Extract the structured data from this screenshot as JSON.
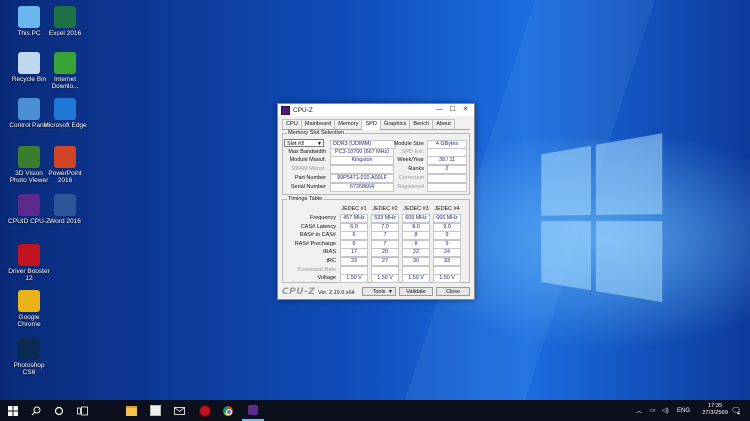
{
  "desktop_icons": [
    {
      "label": "This PC",
      "icon": "this-pc-icon",
      "color": "#6ab7f0"
    },
    {
      "label": "Excel 2016",
      "icon": "excel-icon",
      "color": "#1e7145"
    },
    {
      "label": "Recycle Bin",
      "icon": "recycle-bin-icon",
      "color": "#c0d8f0"
    },
    {
      "label": "Internet Downlo...",
      "icon": "idm-icon",
      "color": "#3aa335"
    },
    {
      "label": "Control Panel",
      "icon": "control-panel-icon",
      "color": "#4b8fd4"
    },
    {
      "label": "Microsoft Edge",
      "icon": "edge-icon",
      "color": "#1f77d6"
    },
    {
      "label": "3D Vision Photo Viewer",
      "icon": "3d-vision-icon",
      "color": "#3a7d2c"
    },
    {
      "label": "PowerPoint 2016",
      "icon": "powerpoint-icon",
      "color": "#d04423"
    },
    {
      "label": "CPUID CPU-Z",
      "icon": "cpuz-icon",
      "color": "#5b2a8c"
    },
    {
      "label": "Word 2016",
      "icon": "word-icon",
      "color": "#2b579a"
    },
    {
      "label": "Driver Booster 12",
      "icon": "driver-booster-icon",
      "color": "#c0141e"
    },
    {
      "label": "Google Chrome",
      "icon": "chrome-icon",
      "color": "#e8b21a"
    },
    {
      "label": "Photoshop CS6",
      "icon": "photoshop-icon",
      "color": "#0b2a52"
    }
  ],
  "window": {
    "title": "CPU-Z",
    "minimize": "—",
    "maximize": "☐",
    "close": "✕",
    "tabs": [
      "CPU",
      "Mainboard",
      "Memory",
      "SPD",
      "Graphics",
      "Bench",
      "About"
    ],
    "active_tab": "SPD",
    "slot_group_title": "Memory Slot Selection",
    "slot_selected": "Slot #2",
    "memory_type": "DDR3 (UDIMM)",
    "labels": {
      "module_size": "Module Size",
      "max_bandwidth": "Max Bandwidth",
      "spd_ext": "SPD Ext.",
      "module_manuf": "Module Manuf.",
      "week_year": "Week/Year",
      "dram_manuf": "DRAM Manuf.",
      "ranks": "Ranks",
      "part_number": "Part Number",
      "correction": "Correction",
      "serial_number": "Serial Number",
      "registered": "Registered"
    },
    "values": {
      "module_size": "4 GBytes",
      "max_bandwidth": "PC3-10700 (667 MHz)",
      "spd_ext": "",
      "module_manuf": "Kingston",
      "week_year": "38 / 11",
      "dram_manuf": "",
      "ranks": "2",
      "part_number": "99P5471-010.A00LF",
      "correction": "",
      "serial_number": "67268664",
      "registered": ""
    },
    "timings_title": "Timings Table",
    "timing_headers": [
      "JEDEC #1",
      "JEDEC #2",
      "JEDEC #3",
      "JEDEC #4"
    ],
    "timing_rows": [
      {
        "label": "Frequency",
        "values": [
          "457 MHz",
          "533 MHz",
          "609 MHz",
          "666 MHz"
        ]
      },
      {
        "label": "CAS# Latency",
        "values": [
          "6.0",
          "7.0",
          "8.0",
          "9.0"
        ]
      },
      {
        "label": "RAS# to CAS#",
        "values": [
          "6",
          "7",
          "8",
          "9"
        ]
      },
      {
        "label": "RAS# Precharge",
        "values": [
          "6",
          "7",
          "8",
          "9"
        ]
      },
      {
        "label": "tRAS",
        "values": [
          "17",
          "20",
          "22",
          "24"
        ]
      },
      {
        "label": "tRC",
        "values": [
          "23",
          "27",
          "30",
          "33"
        ]
      },
      {
        "label": "Command Rate",
        "values": [
          "",
          "",
          "",
          ""
        ]
      },
      {
        "label": "Voltage",
        "values": [
          "1.50 V",
          "1.50 V",
          "1.50 V",
          "1.50 V"
        ]
      }
    ],
    "brand": "CPU-Z",
    "version": "Ver. 2.19.0.x64",
    "tools": "Tools",
    "validate": "Validate",
    "close_btn": "Close"
  },
  "taskbar": {
    "search_icon": "search-icon",
    "lang": "ENG",
    "time": "17:35",
    "date": "27/3/2569",
    "notification_count": "4"
  }
}
